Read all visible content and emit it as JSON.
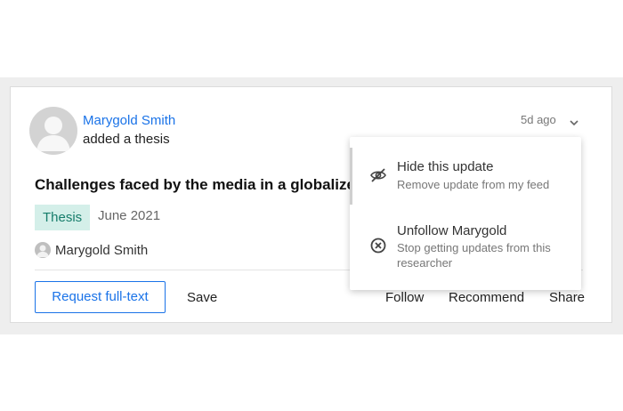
{
  "post": {
    "author_name": "Marygold Smith",
    "action": "added a thesis",
    "time_ago": "5d ago",
    "title": "Challenges faced by the media in a globalized world",
    "type_badge": "Thesis",
    "date": "June 2021",
    "author_chip": "Marygold Smith"
  },
  "actions": {
    "request_label": "Request full-text",
    "save_label": "Save",
    "follow_label": "Follow",
    "recommend_label": "Recommend",
    "share_label": "Share"
  },
  "menu": {
    "hide_title": "Hide this update",
    "hide_sub": "Remove update from my feed",
    "unfollow_title": "Unfollow Marygold",
    "unfollow_sub_line1": "Stop getting updates from this",
    "unfollow_sub_line2": "researcher"
  },
  "icons": {
    "avatar": "person-silhouette",
    "menu_toggle": "chevron-down-icon",
    "hide": "eye-slash-icon",
    "unfollow": "circle-x-icon"
  },
  "colors": {
    "link": "#1a73e8",
    "badge_bg": "#d4efe9",
    "badge_text": "#167d6b",
    "band_bg": "#eeeeee"
  }
}
